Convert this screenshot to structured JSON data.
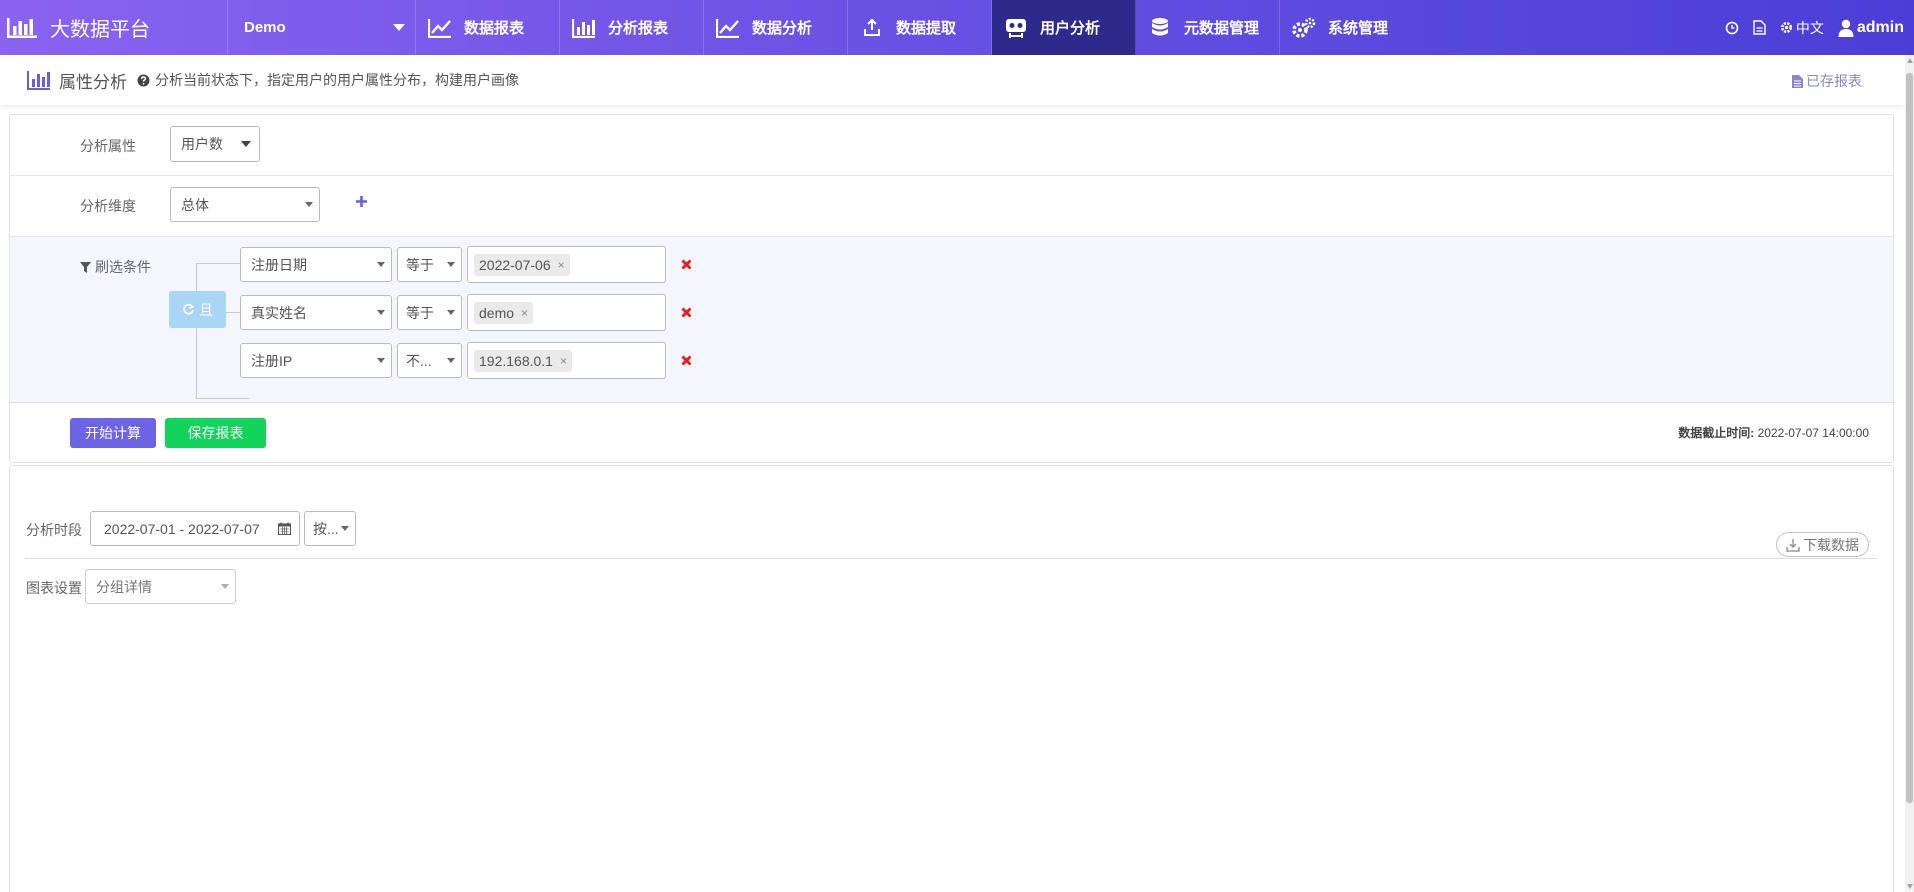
{
  "header": {
    "brand_title": "大数据平台",
    "project": "Demo",
    "nav": [
      {
        "label": "数据报表",
        "icon": "line-chart-icon"
      },
      {
        "label": "分析报表",
        "icon": "bar-chart-icon"
      },
      {
        "label": "数据分析",
        "icon": "line-chart-icon"
      },
      {
        "label": "数据提取",
        "icon": "upload-icon"
      },
      {
        "label": "用户分析",
        "icon": "user-analysis-icon",
        "active": true
      },
      {
        "label": "元数据管理",
        "icon": "database-icon"
      },
      {
        "label": "系统管理",
        "icon": "gears-icon"
      }
    ],
    "language": "中文",
    "user": "admin"
  },
  "page": {
    "title": "属性分析",
    "description": "分析当前状态下，指定用户的用户属性分布，构建用户画像",
    "saved_reports": "已存报表"
  },
  "config": {
    "attribute_label": "分析属性",
    "attribute_value": "用户数",
    "dimension_label": "分析维度",
    "dimension_value": "总体",
    "filter_label": "刷选条件",
    "logic_label": "且",
    "filters": [
      {
        "field": "注册日期",
        "operator": "等于",
        "value": "2022-07-06"
      },
      {
        "field": "真实姓名",
        "operator": "等于",
        "value": "demo"
      },
      {
        "field": "注册IP",
        "operator": "不...",
        "value": "192.168.0.1"
      }
    ],
    "calc_button": "开始计算",
    "save_button": "保存报表",
    "cutoff_label": "数据截止时间:",
    "cutoff_value": "2022-07-07 14:00:00"
  },
  "result": {
    "period_label": "分析时段",
    "date_range": "2022-07-01 - 2022-07-07",
    "granularity": "按...",
    "download_label": "下载数据",
    "chart_settings_label": "图表设置",
    "chart_settings_value": "分组详情"
  },
  "colors": {
    "nav_gradient_start": "#8a63f0",
    "nav_gradient_end": "#4b3ed6",
    "nav_active": "#2e2a8c",
    "primary_button": "#6c63e5",
    "success_button": "#12d45a",
    "delete_icon": "#e02020",
    "filter_bg": "#f5f6fd",
    "logic_button": "#a8d6f4"
  }
}
